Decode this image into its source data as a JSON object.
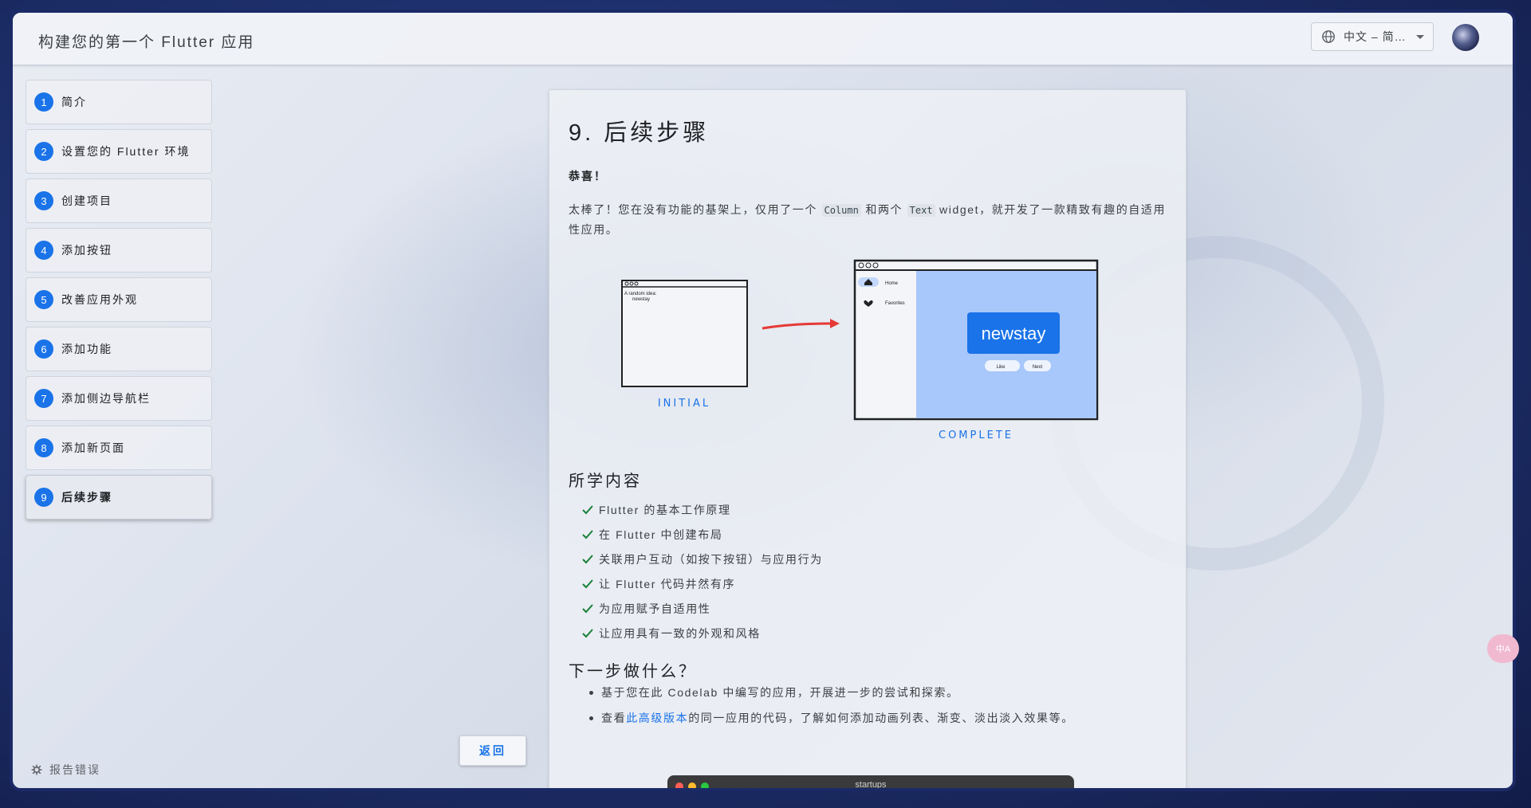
{
  "header": {
    "title": "构建您的第一个 Flutter 应用",
    "language": "中文 – 简…",
    "language_icon": "globe-icon",
    "avatar": "user-avatar"
  },
  "sidebar": {
    "steps": [
      {
        "num": "1",
        "label": "简介"
      },
      {
        "num": "2",
        "label": "设置您的 Flutter 环境"
      },
      {
        "num": "3",
        "label": "创建项目"
      },
      {
        "num": "4",
        "label": "添加按钮"
      },
      {
        "num": "5",
        "label": "改善应用外观"
      },
      {
        "num": "6",
        "label": "添加功能"
      },
      {
        "num": "7",
        "label": "添加侧边导航栏"
      },
      {
        "num": "8",
        "label": "添加新页面"
      },
      {
        "num": "9",
        "label": "后续步骤"
      }
    ],
    "active_step": 9,
    "report_label": "报告错误",
    "report_icon": "bug-icon",
    "back_label": "返回"
  },
  "content": {
    "title": "9. 后续步骤",
    "congrats": "恭喜！",
    "intro_1": "太棒了！您在没有功能的基架上，仅用了一个 ",
    "code_1": "Column",
    "intro_2": " 和两个 ",
    "code_2": "Text",
    "intro_3": " widget，就开发了一款精致有趣的自适用性应用。",
    "illustration": {
      "initial_window_text_1": "A random idea:",
      "initial_window_text_2": "newstay",
      "initial_caption": "INITIAL",
      "complete_nav_home": "Home",
      "complete_nav_favorites": "Favorites",
      "complete_word": "newstay",
      "complete_like": "Like",
      "complete_next": "Next",
      "complete_caption": "COMPLETE"
    },
    "learned_heading": "所学内容",
    "learned": [
      "Flutter 的基本工作原理",
      "在 Flutter 中创建布局",
      "关联用户互动（如按下按钮）与应用行为",
      "让 Flutter 代码井然有序",
      "为应用赋予自适用性",
      "让应用具有一致的外观和风格"
    ],
    "next_heading": "下一步做什么？",
    "next_1": "基于您在此 Codelab 中编写的应用，开展进一步的尝试和探索。",
    "next_2_pre": "查看",
    "next_2_link": "此高级版本",
    "next_2_post": "的同一应用的代码，了解如何添加动画列表、渐变、淡出淡入效果等。",
    "preview_window_title": "startups"
  },
  "floating": {
    "label": "中A"
  },
  "colors": {
    "accent": "#1a73e8",
    "check": "#188038",
    "arrow": "#e53935",
    "sketch_blue": "#a8c7fa"
  }
}
